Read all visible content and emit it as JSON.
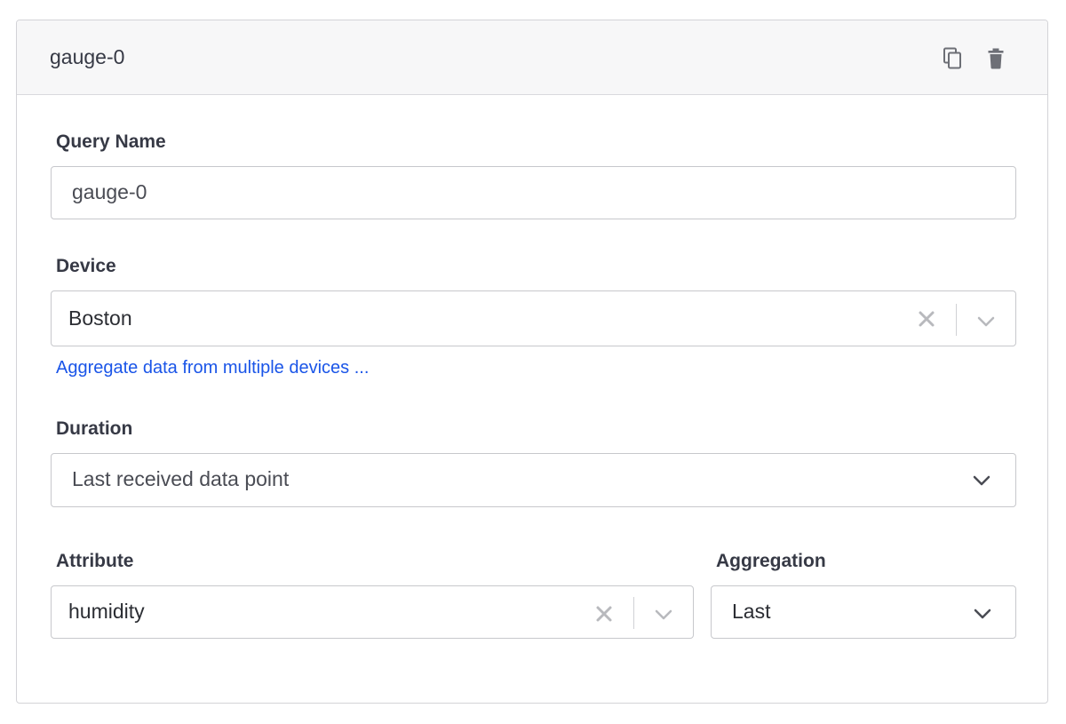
{
  "card": {
    "title": "gauge-0",
    "icons": {
      "copy": "copy-icon",
      "delete": "trash-icon"
    }
  },
  "query_name": {
    "label": "Query Name",
    "value": "gauge-0"
  },
  "device": {
    "label": "Device",
    "value": "Boston",
    "link": "Aggregate data from multiple devices ..."
  },
  "duration": {
    "label": "Duration",
    "value": "Last received data point"
  },
  "attribute": {
    "label": "Attribute",
    "value": "humidity"
  },
  "aggregation": {
    "label": "Aggregation",
    "value": "Last"
  },
  "colors": {
    "link": "#1a55e8",
    "text": "#363945",
    "border": "#c7c8cc",
    "header_bg": "#f7f7f8"
  }
}
